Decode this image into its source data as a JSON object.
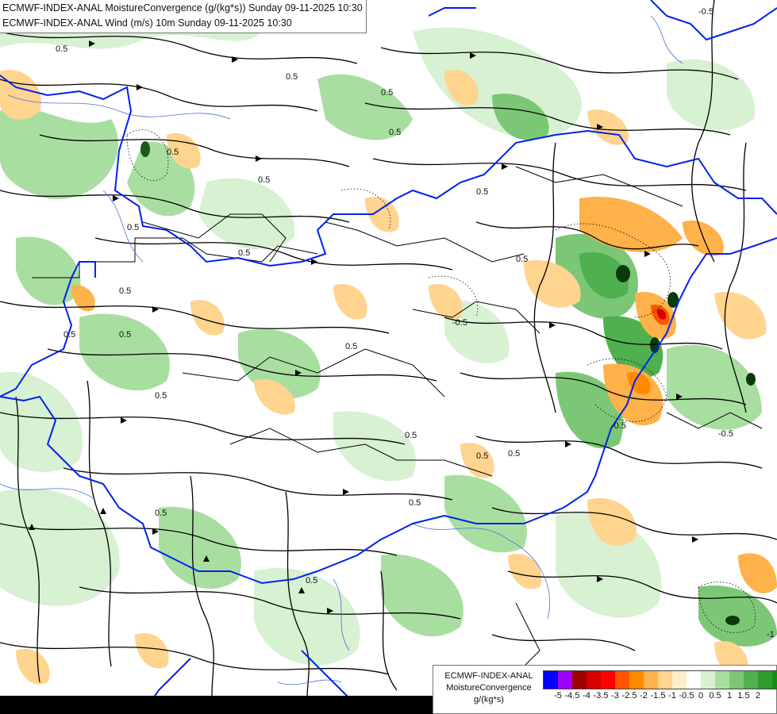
{
  "titles": {
    "line1": "ECMWF-INDEX-ANAL MoistureConvergence (g/(kg*s)) Sunday 09-11-2025 10:30",
    "line2": "ECMWF-INDEX-ANAL Wind (m/s) 10m Sunday 09-11-2025 10:30"
  },
  "legend": {
    "line1": "ECMWF-INDEX-ANAL",
    "line2": "MoistureConvergence",
    "line3": "g/(kg*s)",
    "colors": [
      "#0000ff",
      "#9a00ff",
      "#a00000",
      "#d40000",
      "#ff0000",
      "#ff5500",
      "#ff8a00",
      "#ffb14a",
      "#ffd48f",
      "#fdeecb",
      "#ffffff",
      "#d7f1d2",
      "#a9dea1",
      "#7bc775",
      "#50b050",
      "#2f9b2f",
      "#139113"
    ],
    "ticks": [
      "-5",
      "-4.5",
      "-4",
      "-3.5",
      "-3",
      "-2.5",
      "-2",
      "-1.5",
      "-1",
      "-0.5",
      "0",
      "0.5",
      "1",
      "1.5",
      "2"
    ]
  },
  "map": {
    "contour_labels": [
      "0.5",
      "0.5",
      "0.5",
      "0.5",
      "0.5",
      "-0.5",
      "-0.5",
      "0.5",
      "0.5",
      "0.5",
      "-0.5",
      "0.5",
      "0.5",
      "0.5",
      "0.5",
      "-0.5",
      "0.5",
      "0.5",
      "0.5",
      "0.5",
      "0.5",
      "0.5",
      "0.5",
      "0.5",
      "0.5",
      "-1"
    ],
    "colors": {
      "border_country": "#0022ee",
      "border_region": "#000000",
      "river": "#4a6fd8",
      "streamline": "#000000"
    }
  }
}
